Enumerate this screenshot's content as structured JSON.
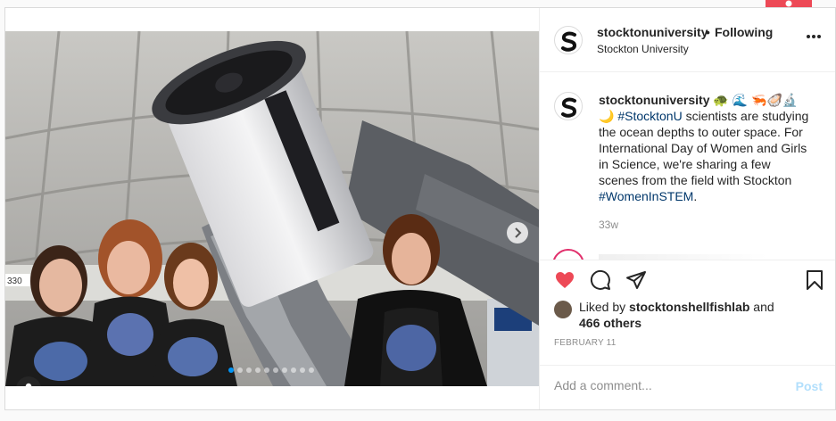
{
  "header": {
    "username": "stocktonuniversity",
    "separator": "•",
    "follow_status": "Following",
    "subtitle": "Stockton University",
    "more_icon": "more-horizontal-icon"
  },
  "caption": {
    "username": "stocktonuniversity",
    "emojis": "🐢 🌊 🦐🦪🔬 🌙",
    "hashtag1": "#StocktonU",
    "text1": " scientists are studying the ocean depths to outer space. For International Day of Women and Girls in Science, we're sharing a few scenes from the field with Stockton ",
    "hashtag2": "#WomenInSTEM",
    "text2": ".",
    "time": "33w"
  },
  "actions": {
    "like_icon": "heart-filled-icon",
    "comment_icon": "comment-icon",
    "share_icon": "paper-plane-icon",
    "save_icon": "bookmark-icon",
    "like_color": "#ed4956"
  },
  "likes": {
    "prefix": "Liked by ",
    "user": "stocktonshellfishlab",
    "and": " and",
    "others": "466 others"
  },
  "date": "FEBRUARY 11",
  "comment_box": {
    "placeholder": "Add a comment...",
    "post_label": "Post"
  },
  "carousel": {
    "slide_count": 10,
    "current_slide": 1
  },
  "colors": {
    "accent": "#0095f6",
    "link": "#00376b",
    "notification": "#ed4956"
  }
}
